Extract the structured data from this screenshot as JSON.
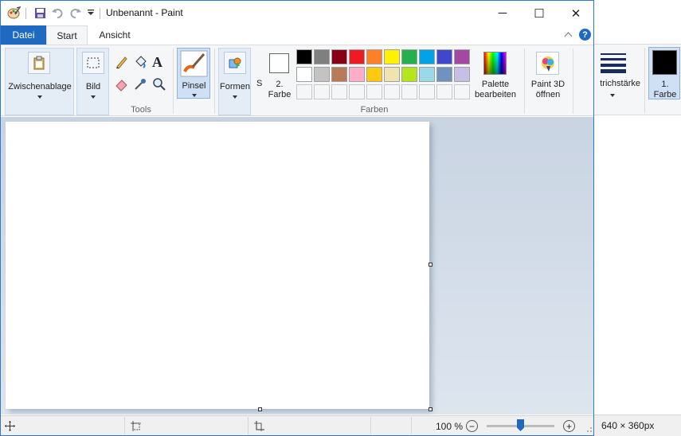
{
  "app": {
    "title": "Unbenannt - Paint"
  },
  "titlebar": {
    "minimize": "─",
    "maximize": "☐",
    "close": "✕"
  },
  "tabs": {
    "file": "Datei",
    "start": "Start",
    "view": "Ansicht"
  },
  "ribbon": {
    "clipboard_label": "Zwischenablage",
    "image_label": "Bild",
    "tools_label": "Tools",
    "brushes_label": "Pinsel",
    "shapes_label": "Formen",
    "shapes_cut": "S",
    "color2_label_1": "2.",
    "color2_label_2": "Farbe",
    "colors_group_label": "Farben",
    "edit_palette_1": "Palette",
    "edit_palette_2": "bearbeiten",
    "paint3d_1": "Paint 3D",
    "paint3d_2": "öffnen",
    "palette_row1": [
      "#000000",
      "#7f7f7f",
      "#880015",
      "#ed1c24",
      "#ff7f27",
      "#fff200",
      "#22b14c",
      "#00a2e8",
      "#3f48cc",
      "#a349a4"
    ],
    "palette_row2": [
      "#ffffff",
      "#c3c3c3",
      "#b97a57",
      "#ffaec9",
      "#ffc90e",
      "#efe4b0",
      "#b5e61d",
      "#99d9ea",
      "#7092be",
      "#c8bfe7"
    ]
  },
  "right_ribbon": {
    "stroke_label": "trichstärke",
    "color1_label_1": "1.",
    "color1_label_2": "Farbe",
    "color1": "#000000"
  },
  "status": {
    "zoom": "100 %",
    "dimensions": "640 × 360px",
    "zoom_minus": "−",
    "zoom_plus": "+"
  }
}
